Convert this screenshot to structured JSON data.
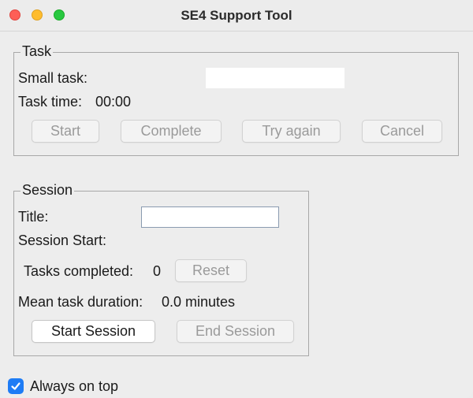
{
  "window": {
    "title": "SE4 Support Tool"
  },
  "task": {
    "legend": "Task",
    "small_task_label": "Small task:",
    "small_task_value": "",
    "time_label": "Task time:",
    "time_value": "00:00",
    "buttons": {
      "start": "Start",
      "complete": "Complete",
      "try_again": "Try again",
      "cancel": "Cancel"
    }
  },
  "session": {
    "legend": "Session",
    "title_label": "Title:",
    "title_value": "",
    "start_label": "Session Start:",
    "tasks_completed_label": "Tasks completed:",
    "tasks_completed_value": "0",
    "reset_label": "Reset",
    "mean_label": "Mean task duration:",
    "mean_value": "0.0 minutes",
    "start_session_label": "Start Session",
    "end_session_label": "End Session"
  },
  "always_on_top": {
    "label": "Always on top",
    "checked": true
  },
  "colors": {
    "accent": "#1e7cf5",
    "close": "#fe5f57",
    "minimize": "#febc2e",
    "maximize": "#28c840"
  }
}
